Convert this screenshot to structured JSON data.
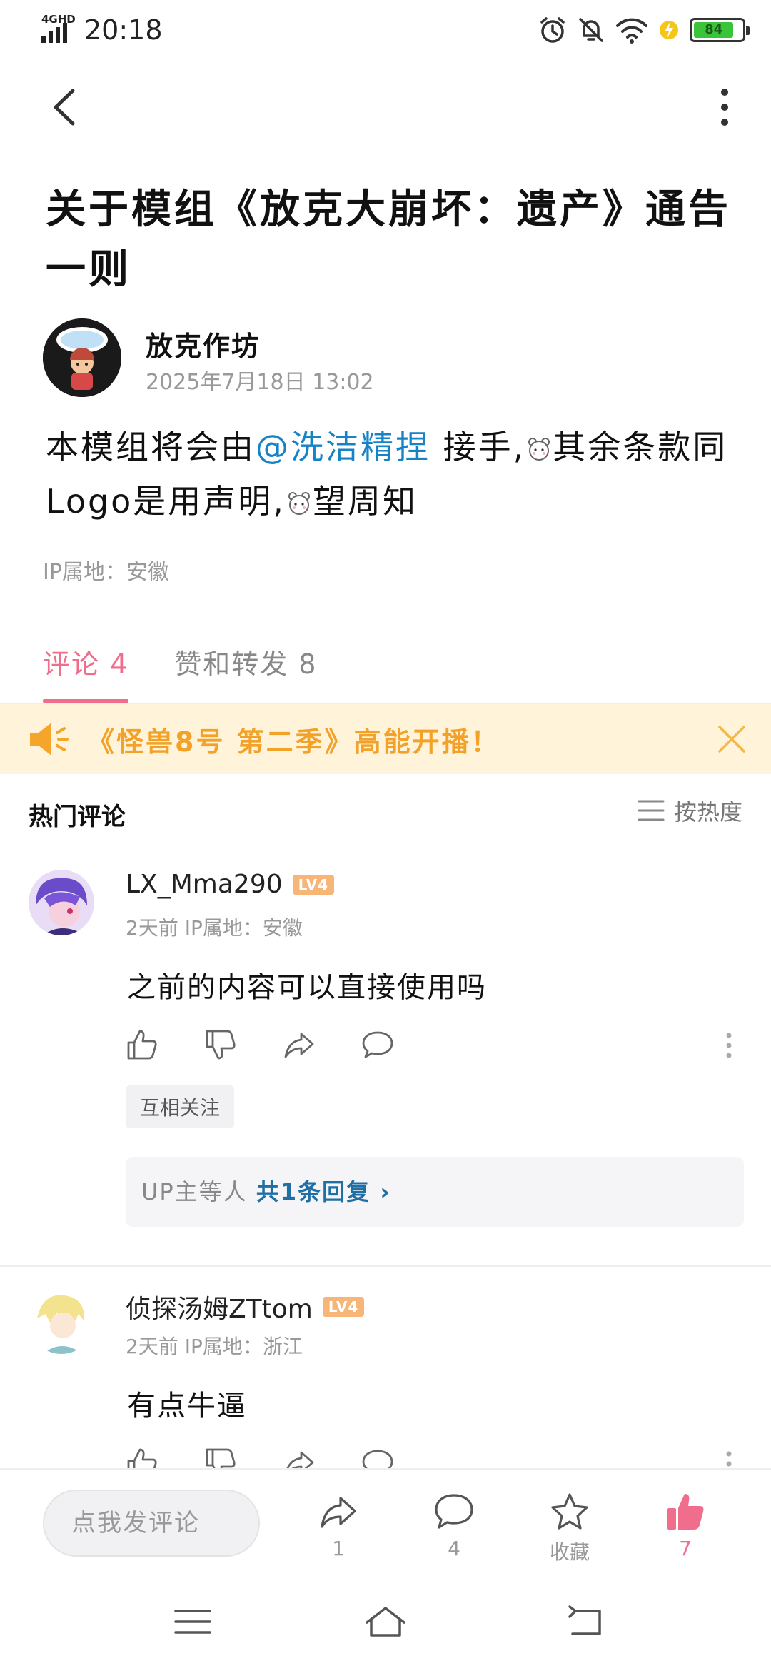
{
  "status_bar": {
    "network": "4GHD",
    "time": "20:18",
    "battery": "84",
    "battery_level": 0.84
  },
  "post": {
    "title": "关于模组《放克大崩坏：遗产》通告一则",
    "author": {
      "name": "放克作坊",
      "time": "2025年7月18日 13:02"
    },
    "body": {
      "part1": "本模组将会由",
      "mention": "@洗洁精捏",
      "part2": " 接手,",
      "part3": "其余条款同Logo是用声明,",
      "part4": "望周知"
    },
    "ip_location": "IP属地：安徽"
  },
  "tabs": [
    {
      "label": "评论 4",
      "active": true
    },
    {
      "label": "赞和转发 8",
      "active": false
    }
  ],
  "banner": {
    "text": "《怪兽8号 第二季》高能开播！"
  },
  "comments_header": {
    "title": "热门评论",
    "sort_label": "按热度"
  },
  "comments": [
    {
      "username": "LX_Mma290",
      "level": "LV4",
      "meta": "2天前 IP属地：安徽",
      "text": "之前的内容可以直接使用吗",
      "tag": "互相关注",
      "reply_prefix": "UP主等人 ",
      "reply_link": "共1条回复 ›"
    },
    {
      "username": "侦探汤姆ZTtom",
      "level": "LV4",
      "meta": "2天前 IP属地：浙江",
      "text": "有点牛逼"
    }
  ],
  "bottom_bar": {
    "comment_placeholder": "点我发评论",
    "share_count": "1",
    "comment_count": "4",
    "favorite_label": "收藏",
    "like_count": "7"
  },
  "colors": {
    "accent_pink": "#f06d8c",
    "mention_blue": "#1583c6",
    "banner_bg": "#fff3d9",
    "banner_text": "#f2a229",
    "level_badge": "#f7b678"
  }
}
